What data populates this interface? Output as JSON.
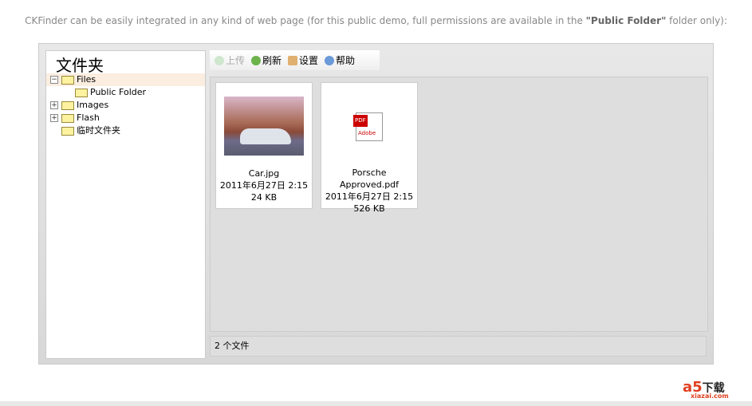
{
  "intro": {
    "text": "CKFinder can be easily integrated in any kind of web page (for this public demo, full permissions are available in the ",
    "bold": "\"Public Folder\"",
    "end": " folder only):"
  },
  "sidebar": {
    "title": "文件夹",
    "nodes": [
      {
        "label": "Files",
        "toggle": "−"
      },
      {
        "label": "Public Folder",
        "toggle": ""
      },
      {
        "label": "Images",
        "toggle": "+"
      },
      {
        "label": "Flash",
        "toggle": "+"
      },
      {
        "label": "临时文件夹",
        "toggle": ""
      }
    ]
  },
  "toolbar": {
    "upload": "上传",
    "refresh": "刷新",
    "settings": "设置",
    "help": "帮助"
  },
  "files": [
    {
      "name": "Car.jpg",
      "date": "2011年6月27日 2:15",
      "size": "24 KB"
    },
    {
      "name": "Porsche Approved.pdf",
      "date": "2011年6月27日 2:15",
      "size": "526 KB"
    }
  ],
  "pdf": {
    "badge": "PDF",
    "brand": "Adobe"
  },
  "status": "2 个文件",
  "logo": {
    "a": "a5",
    "text": "下载",
    "sub": "xiazai.com"
  }
}
